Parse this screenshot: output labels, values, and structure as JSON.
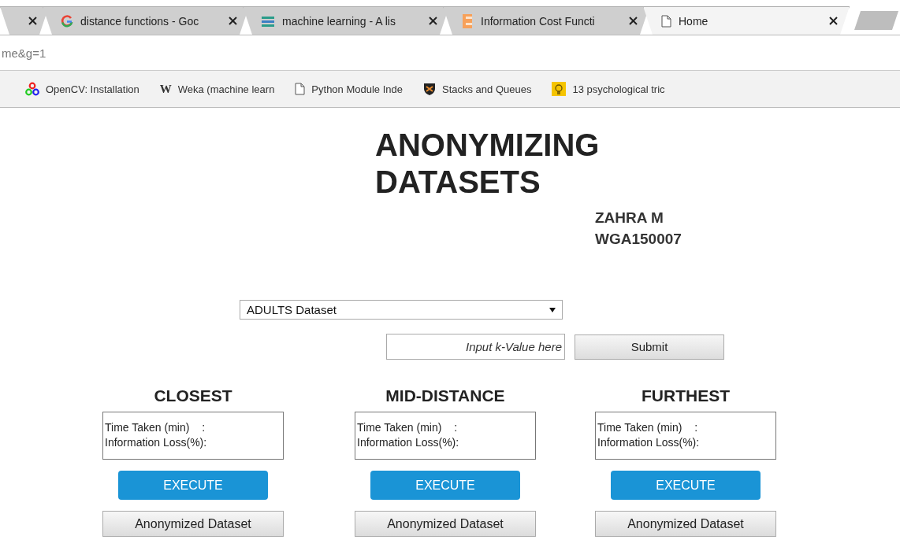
{
  "browser": {
    "tabs": [
      {
        "selected": false
      },
      {
        "title": "distance functions - Goc",
        "selected": false
      },
      {
        "title": "machine learning - A lis",
        "selected": false
      },
      {
        "title": "Information Cost Functi",
        "selected": false
      },
      {
        "title": "Home",
        "selected": true
      }
    ],
    "address": "me&g=1",
    "bookmarks": [
      {
        "title": "OpenCV: Installation"
      },
      {
        "glyph": "W",
        "title": "Weka (machine learn"
      },
      {
        "title": "Python Module Inde"
      },
      {
        "title": "Stacks and Queues"
      },
      {
        "title": "13 psychological tric"
      }
    ]
  },
  "page": {
    "title_lines": [
      "ANONYMIZING",
      "DATASETS"
    ],
    "author_lines": [
      "ZAHRA M",
      "WGA150007"
    ],
    "dataset_select": {
      "value": "ADULTS Dataset"
    },
    "k_input": {
      "placeholder": "Input k-Value here"
    },
    "submit": "Submit",
    "columns": [
      {
        "heading": "CLOSEST",
        "time_label": "Time Taken (min)",
        "time_sep": ":",
        "loss_label": "Information Loss(%):",
        "execute": "EXECUTE",
        "download": "Anonymized Dataset"
      },
      {
        "heading": "MID-DISTANCE",
        "time_label": "Time Taken (min)",
        "time_sep": ":",
        "loss_label": "Information Loss(%):",
        "execute": "EXECUTE",
        "download": "Anonymized Dataset"
      },
      {
        "heading": "FURTHEST",
        "time_label": "Time Taken (min)",
        "time_sep": ":",
        "loss_label": "Information Loss(%):",
        "execute": "EXECUTE",
        "download": "Anonymized Dataset"
      }
    ]
  }
}
